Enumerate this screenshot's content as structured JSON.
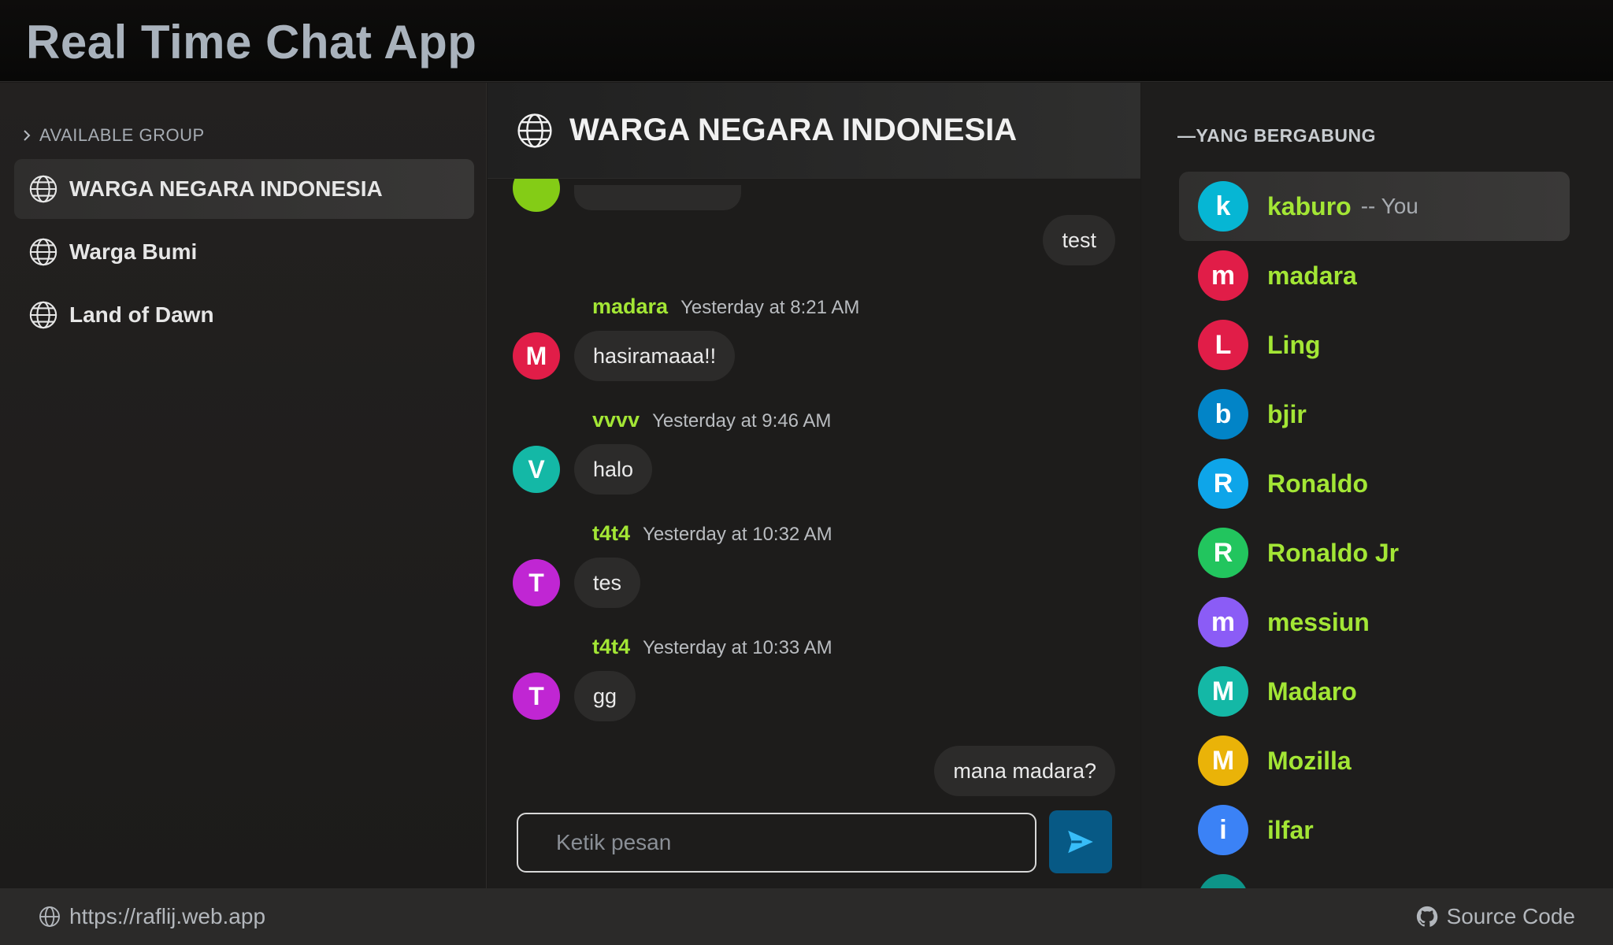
{
  "app": {
    "title": "Real Time Chat App"
  },
  "sidebar": {
    "header": "AVAILABLE GROUP",
    "groups": [
      {
        "label": "WARGA NEGARA INDONESIA",
        "active": true
      },
      {
        "label": "Warga Bumi",
        "active": false
      },
      {
        "label": "Land of Dawn",
        "active": false
      }
    ]
  },
  "chat": {
    "title": "WARGA NEGARA INDONESIA",
    "messages": [
      {
        "mine": true,
        "text": "test"
      },
      {
        "author": "madara",
        "time": "Yesterday at 8:21 AM",
        "initial": "M",
        "avatar_color": "#e11d48",
        "text": "hasiramaaa!!"
      },
      {
        "author": "vvvv",
        "time": "Yesterday at 9:46 AM",
        "initial": "V",
        "avatar_color": "#14b8a6",
        "text": "halo"
      },
      {
        "author": "t4t4",
        "time": "Yesterday at 10:32 AM",
        "initial": "T",
        "avatar_color": "#c026d3",
        "text": "tes"
      },
      {
        "author": "t4t4",
        "time": "Yesterday at 10:33 AM",
        "initial": "T",
        "avatar_color": "#c026d3",
        "text": "gg"
      },
      {
        "mine": true,
        "text": "mana madara?"
      }
    ],
    "input": {
      "placeholder": "Ketik pesan",
      "value": ""
    },
    "send_icon": "send-icon",
    "accent_color": "#075985"
  },
  "members": {
    "header": "—YANG BERGABUNG",
    "self_suffix": "-- You",
    "list": [
      {
        "initial": "k",
        "name": "kaburo",
        "color": "#06b6d4",
        "self": true
      },
      {
        "initial": "m",
        "name": "madara",
        "color": "#e11d48"
      },
      {
        "initial": "L",
        "name": "Ling",
        "color": "#e11d48"
      },
      {
        "initial": "b",
        "name": "bjir",
        "color": "#0284c7"
      },
      {
        "initial": "R",
        "name": "Ronaldo",
        "color": "#0ea5e9"
      },
      {
        "initial": "R",
        "name": "Ronaldo Jr",
        "color": "#22c55e"
      },
      {
        "initial": "m",
        "name": "messiun",
        "color": "#8b5cf6"
      },
      {
        "initial": "M",
        "name": "Madaro",
        "color": "#14b8a6"
      },
      {
        "initial": "M",
        "name": "Mozilla",
        "color": "#eab308"
      },
      {
        "initial": "i",
        "name": "ilfar",
        "color": "#3b82f6"
      }
    ],
    "name_color": "#a3e635"
  },
  "footer": {
    "url": "https://raflij.web.app",
    "source": "Source Code"
  }
}
